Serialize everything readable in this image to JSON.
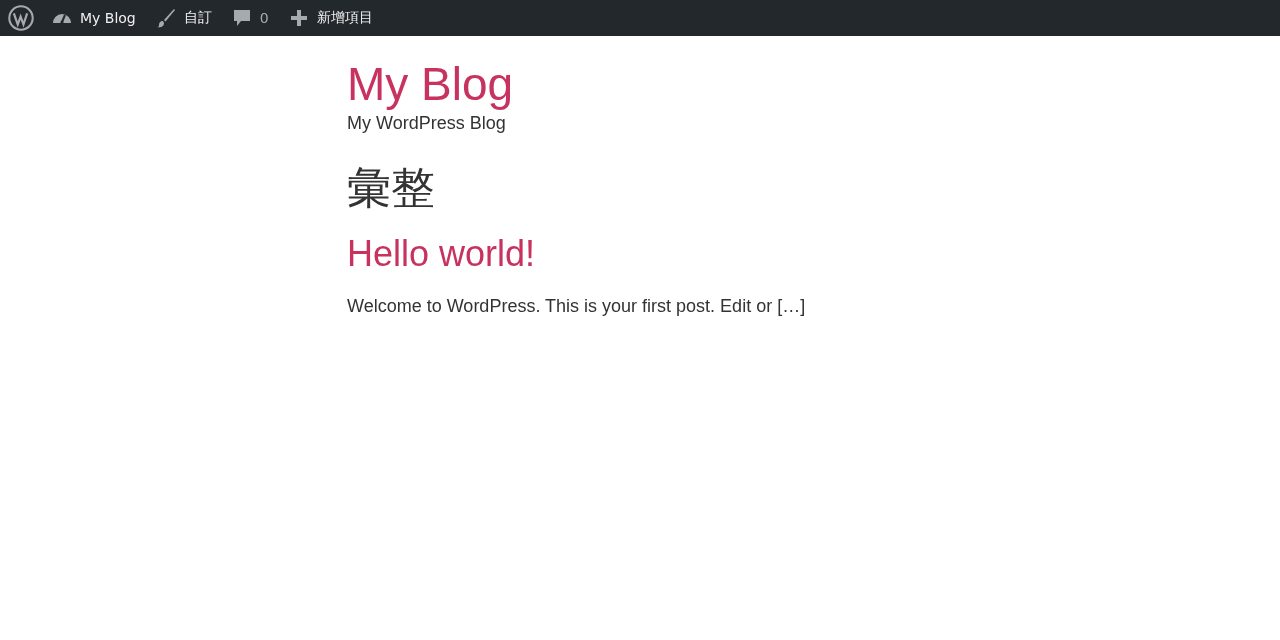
{
  "admin_bar": {
    "items": [
      {
        "kind": "logo"
      },
      {
        "kind": "dashboard",
        "label": "My Blog"
      },
      {
        "kind": "customize",
        "label": "自訂"
      },
      {
        "kind": "comments",
        "label": "0"
      },
      {
        "kind": "new",
        "label": "新增項目"
      }
    ]
  },
  "site": {
    "title": "My Blog",
    "tagline": "My WordPress Blog"
  },
  "page_title": "彙整",
  "posts": [
    {
      "title": "Hello world!",
      "excerpt": "Welcome to WordPress. This is your first post. Edit or […]"
    }
  ]
}
